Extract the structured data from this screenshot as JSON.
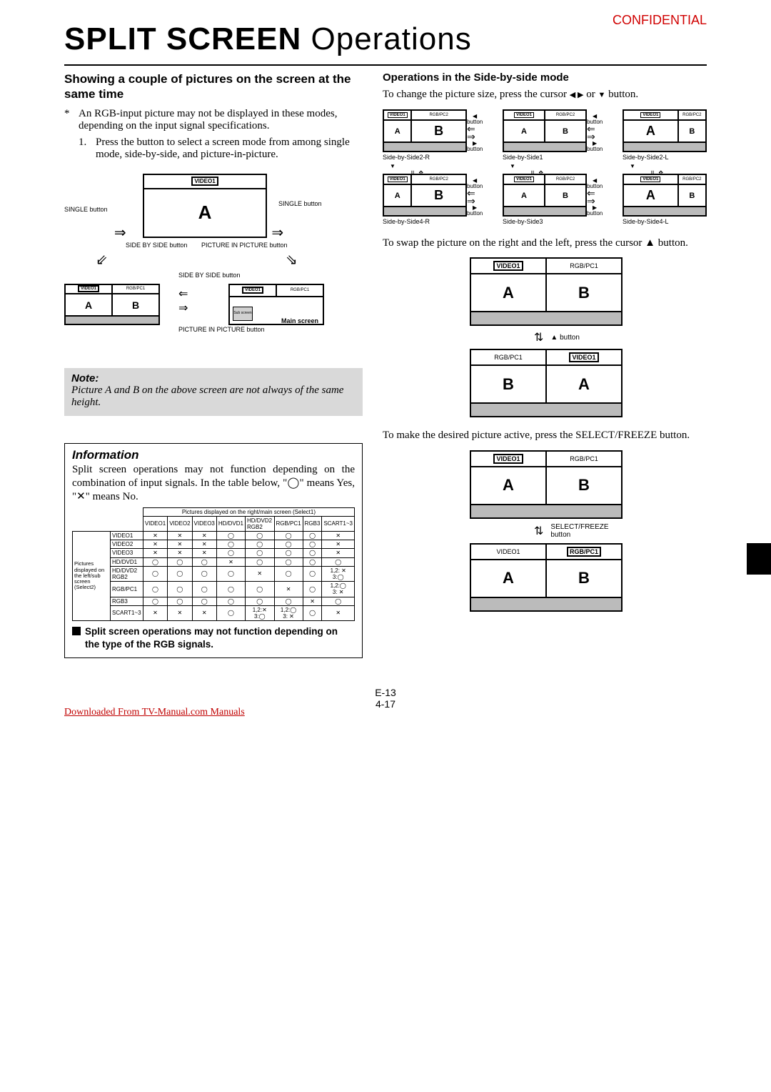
{
  "meta": {
    "confidential": "CONFIDENTIAL",
    "title_bold": "SPLIT SCREEN",
    "title_light": "Operations",
    "page_e": "E-13",
    "page_local": "4-17",
    "download": "Downloaded From TV-Manual.com Manuals"
  },
  "left": {
    "heading": "Showing a couple of pictures on the screen at the same time",
    "star_note": "An RGB-input picture may not be displayed in these modes, depending on the input signal specifications.",
    "step1": "Press the button to select a screen mode from among single mode, side-by-side, and picture-in-picture.",
    "dlabels": {
      "video1": "VIDEO1",
      "rgbpc1": "RGB/PC1",
      "single_btn_l": "SINGLE button",
      "single_btn_r": "SINGLE button",
      "sbs_btn": "SIDE BY SIDE button",
      "pip_btn": "PICTURE IN PICTURE button",
      "main_screen": "Main screen",
      "sub_screen": "Sub screen",
      "A": "A",
      "B": "B"
    },
    "note_title": "Note:",
    "note_text": "Picture A and B on the above screen are not always of the same height.",
    "info_title": "Information",
    "info_text": "Split screen operations may not function depending on the combination of input signals. In the table below, \"◯\" means Yes, \"✕\" means No.",
    "table": {
      "top_caption": "Pictures displayed on the right/main screen (Select1)",
      "side_caption": "Pictures displayed on the left/sub screen (Select2)",
      "cols": [
        "VIDEO1",
        "VIDEO2",
        "VIDEO3",
        "HD/DVD1",
        "HD/DVD2 RGB2",
        "RGB/PC1",
        "RGB3",
        "SCART1~3"
      ],
      "rows": [
        {
          "label": "VIDEO1",
          "cells": [
            "✕",
            "✕",
            "✕",
            "◯",
            "◯",
            "◯",
            "◯",
            "✕"
          ]
        },
        {
          "label": "VIDEO2",
          "cells": [
            "✕",
            "✕",
            "✕",
            "◯",
            "◯",
            "◯",
            "◯",
            "✕"
          ]
        },
        {
          "label": "VIDEO3",
          "cells": [
            "✕",
            "✕",
            "✕",
            "◯",
            "◯",
            "◯",
            "◯",
            "✕"
          ]
        },
        {
          "label": "HD/DVD1",
          "cells": [
            "◯",
            "◯",
            "◯",
            "✕",
            "◯",
            "◯",
            "◯",
            "◯"
          ]
        },
        {
          "label": "HD/DVD2 RGB2",
          "cells": [
            "◯",
            "◯",
            "◯",
            "◯",
            "✕",
            "◯",
            "◯",
            "1,2: ✕\n3:◯"
          ]
        },
        {
          "label": "RGB/PC1",
          "cells": [
            "◯",
            "◯",
            "◯",
            "◯",
            "◯",
            "✕",
            "◯",
            "1,2:◯\n3: ✕"
          ]
        },
        {
          "label": "RGB3",
          "cells": [
            "◯",
            "◯",
            "◯",
            "◯",
            "◯",
            "◯",
            "✕",
            "◯"
          ]
        },
        {
          "label": "SCART1~3",
          "cells": [
            "✕",
            "✕",
            "✕",
            "◯",
            "1,2:✕\n3:◯",
            "1,2:◯\n3: ✕",
            "◯",
            "✕"
          ]
        }
      ]
    },
    "warn": "Split screen operations may not function depending on the type of the RGB signals."
  },
  "right": {
    "heading": "Operations in the Side-by-side mode",
    "p1_a": "To change the picture size, press the cursor ",
    "p1_b": " or ",
    "p1_c": " button.",
    "modes": {
      "labels": [
        "Side-by-Side2-R",
        "Side-by-Side1",
        "Side-by-Side2-L",
        "Side-by-Side4-R",
        "Side-by-Side3",
        "Side-by-Side4-L"
      ],
      "left_hdr": "VIDEO1",
      "right_hdr": "RGB/PC2",
      "button": "button",
      "left_arrow": "◀",
      "right_arrow": "▶",
      "down_arrow": "▼"
    },
    "p2": "To swap the picture on the right and the left, press the cursor ▲ button.",
    "swap": {
      "a_left": "VIDEO1",
      "a_right": "RGB/PC1",
      "b_left": "RGB/PC1",
      "b_right": "VIDEO1",
      "btn": "▲ button",
      "A": "A",
      "B": "B"
    },
    "p3": "To  make the desired picture active, press the SELECT/FREEZE button.",
    "select": {
      "top_left": "VIDEO1",
      "top_right": "RGB/PC1",
      "bot_left": "VIDEO1",
      "bot_right": "RGB/PC1",
      "btn": "SELECT/FREEZE button",
      "A": "A",
      "B": "B"
    }
  }
}
